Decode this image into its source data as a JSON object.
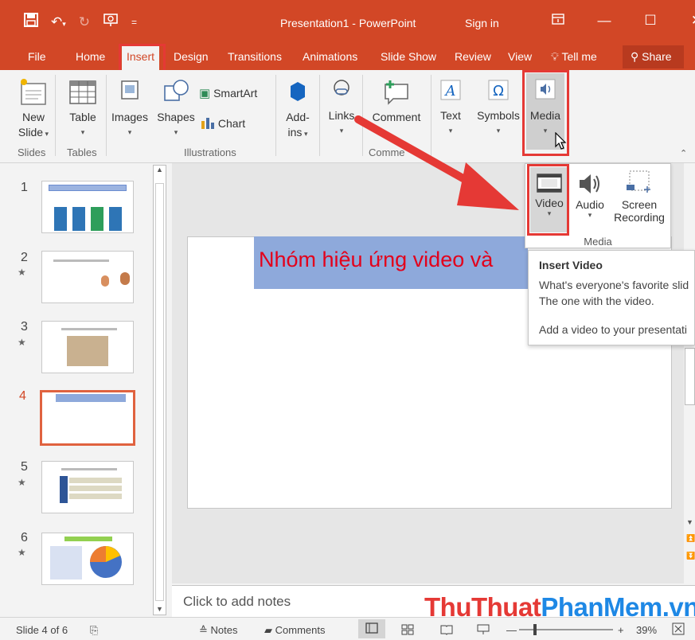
{
  "window": {
    "title": "Presentation1 - PowerPoint",
    "sign_in": "Sign in"
  },
  "tabs": [
    {
      "label": "File"
    },
    {
      "label": "Home"
    },
    {
      "label": "Insert"
    },
    {
      "label": "Design"
    },
    {
      "label": "Transitions"
    },
    {
      "label": "Animations"
    },
    {
      "label": "Slide Show"
    },
    {
      "label": "Review"
    },
    {
      "label": "View"
    },
    {
      "label": "Tell me"
    }
  ],
  "share_label": "Share",
  "ribbon": {
    "new_slide_1": "New",
    "new_slide_2": "Slide",
    "table": "Table",
    "images": "Images",
    "shapes": "Shapes",
    "smartart": "SmartArt",
    "chart": "Chart",
    "addins_1": "Add-",
    "addins_2": "ins",
    "links": "Links",
    "comment": "Comment",
    "text": "Text",
    "symbols": "Symbols",
    "media": "Media",
    "groups": {
      "slides": "Slides",
      "tables": "Tables",
      "illustrations": "Illustrations",
      "comments": "Comme",
      "media": "Media"
    }
  },
  "media_menu": {
    "video": "Video",
    "audio": "Audio",
    "screen_1": "Screen",
    "screen_2": "Recording",
    "group": "Media"
  },
  "tooltip": {
    "title": "Insert Video",
    "line1": "What's everyone's favorite slid",
    "line2": "The one with the video.",
    "line3": "Add a video to your presentati"
  },
  "slides": [
    {
      "num": "1",
      "star": ""
    },
    {
      "num": "2",
      "star": "★"
    },
    {
      "num": "3",
      "star": "★"
    },
    {
      "num": "4",
      "star": ""
    },
    {
      "num": "5",
      "star": "★"
    },
    {
      "num": "6",
      "star": "★"
    }
  ],
  "slide_title": "Nhóm hiệu ứng video và",
  "notes_placeholder": "Click to add notes",
  "status": {
    "slide_of": "Slide 4 of 6",
    "notes": "Notes",
    "comments": "Comments",
    "zoom": "39%"
  },
  "watermark": {
    "part1": "Thu",
    "part2": "Thuat",
    "part3": "Phan",
    "part4": "Mem",
    "part5": ".vn"
  },
  "colors": {
    "accent": "#d24726",
    "highlight_box": "#e53935",
    "slide_title_bg": "#8ea9db",
    "slide_title_text": "#e3001b",
    "arrow": "#e53935"
  }
}
